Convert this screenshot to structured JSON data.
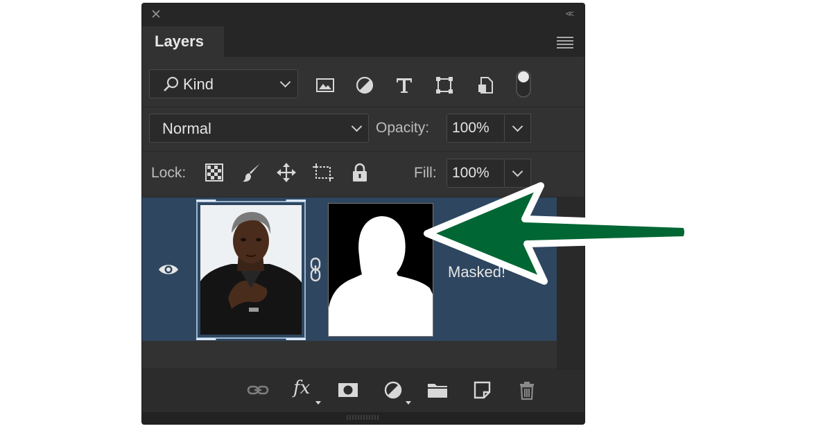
{
  "panel": {
    "tab_title": "Layers",
    "close_glyph": "✕",
    "collapse_glyph": "<<"
  },
  "filter": {
    "kind_label": "Kind",
    "icons": [
      "image-filter-icon",
      "adjustment-filter-icon",
      "type-filter-icon",
      "shape-filter-icon",
      "smart-object-filter-icon",
      "filter-toggle-switch"
    ]
  },
  "blending": {
    "mode": "Normal",
    "opacity_label": "Opacity:",
    "opacity_value": "100%"
  },
  "lock": {
    "label": "Lock:",
    "fill_label": "Fill:",
    "fill_value": "100%",
    "icons": [
      "lock-transparent-pixels-icon",
      "lock-image-pixels-icon",
      "lock-position-icon",
      "lock-artboard-icon",
      "lock-all-icon"
    ]
  },
  "layer": {
    "name": "Masked!",
    "visible": true,
    "selected": true
  },
  "bottom_toolbar": {
    "fx_label": "fx",
    "icons": [
      "link-layers-icon",
      "fx-icon",
      "add-mask-icon",
      "adjustment-layer-icon",
      "new-group-icon",
      "new-layer-icon",
      "delete-icon"
    ]
  },
  "annotation": {
    "arrow_fill": "#006633",
    "arrow_stroke": "#ffffff"
  },
  "colors": {
    "panel_bg": "#323232",
    "selected_row": "#2e4660",
    "text": "#e6e6e6"
  }
}
